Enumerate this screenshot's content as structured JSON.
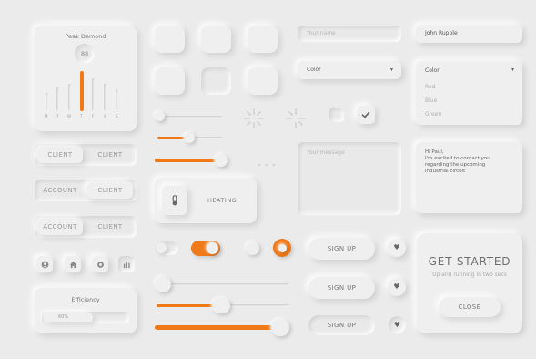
{
  "peak_demand": {
    "title": "Peak Demond",
    "value": "88",
    "days": [
      "M",
      "T",
      "W",
      "T",
      "F",
      "S",
      "S"
    ]
  },
  "segmented": [
    {
      "left": "CLIENT",
      "right": "CLIENT",
      "active": "left"
    },
    {
      "left": "ACCOUNT",
      "right": "CLIENT",
      "active": "right"
    },
    {
      "left": "ACCOUNT",
      "right": "CLIENT",
      "active": "left"
    }
  ],
  "icons_row": [
    "user-icon",
    "home-icon",
    "settings-icon",
    "chart-icon"
  ],
  "efficiency": {
    "title": "Efficiency",
    "value": "60%",
    "level": 0.6
  },
  "heating": {
    "label": "HEATING"
  },
  "name_field": {
    "placeholder": "Your name"
  },
  "name_filled": {
    "value": "John Rupple"
  },
  "color_select": {
    "label": "Color"
  },
  "color_open": {
    "label": "Color",
    "options": [
      "Red",
      "Blue",
      "Green"
    ]
  },
  "message_field": {
    "placeholder": "Your message"
  },
  "message_filled": {
    "text": "Hi Paul,\nI'm excited to contact you regarding the upcoming industrial circuit"
  },
  "signup_buttons": [
    "SIGN UP",
    "SIGN UP",
    "SIGN UP"
  ],
  "get_started": {
    "title": "GET STARTED",
    "subtitle": "Up and running in two secs",
    "button": "CLOSE"
  },
  "sliders": {
    "top_slider": 0.05,
    "mid_slider": 0.45,
    "orange_slider": 0.85,
    "bottom1": 0.05,
    "bottom2": 0.55,
    "bottom3": 0.95
  },
  "colors": {
    "accent": "#f07a1a",
    "background": "#ebebeb"
  }
}
